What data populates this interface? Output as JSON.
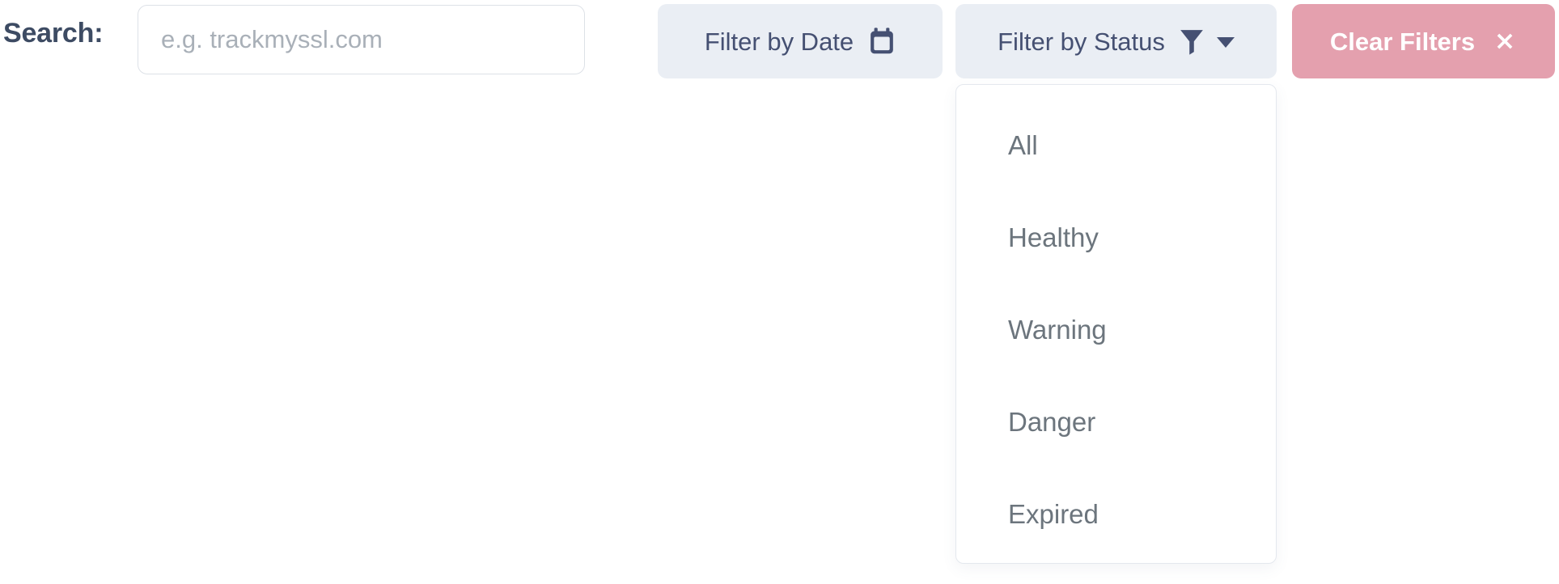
{
  "toolbar": {
    "search_label": "Search:",
    "search_value": "",
    "search_placeholder": "e.g. trackmyssl.com",
    "filter_date_label": "Filter by Date",
    "filter_date_icon": "calendar-icon",
    "filter_status_label": "Filter by Status",
    "filter_status_icon": "funnel-icon",
    "filter_status_caret": "chevron-down-icon",
    "clear_filters_label": "Clear Filters",
    "clear_filters_icon": "close-x-icon"
  },
  "status_menu": {
    "open": true,
    "items": [
      {
        "label": "All"
      },
      {
        "label": "Healthy"
      },
      {
        "label": "Warning"
      },
      {
        "label": "Danger"
      },
      {
        "label": "Expired"
      }
    ]
  },
  "colors": {
    "filter_button_bg": "#eaeef4",
    "filter_button_text": "#455072",
    "clear_button_bg": "#e4a0ae",
    "clear_button_text": "#ffffff",
    "label_text": "#3d4b63",
    "menu_item_text": "#6c757d",
    "placeholder_text": "#a9b0b8",
    "page_bg": "#ffffff"
  }
}
